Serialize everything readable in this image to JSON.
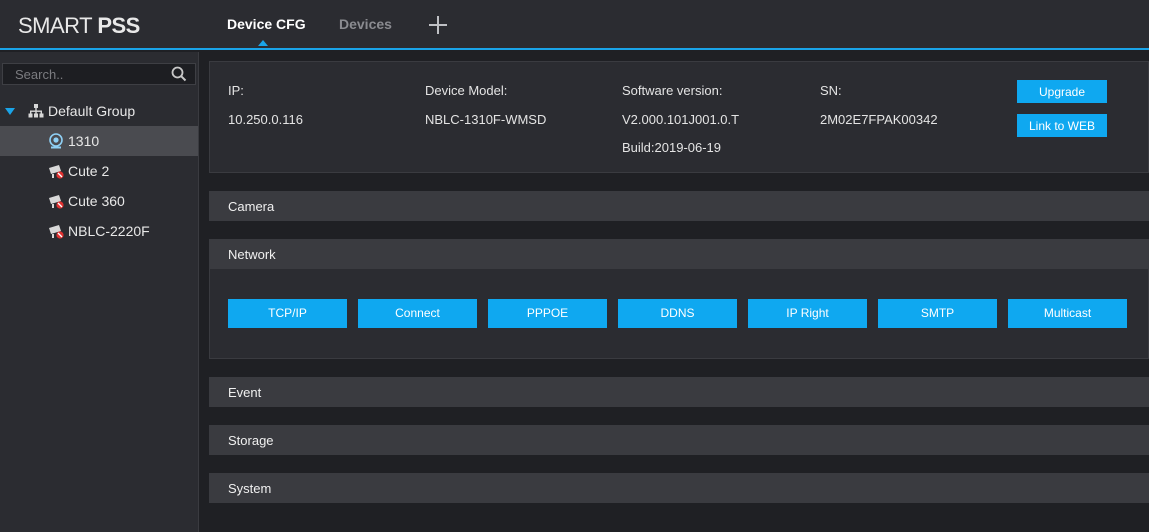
{
  "app": {
    "logo_light": "SMART ",
    "logo_bold": "PSS"
  },
  "tabs": [
    {
      "label": "Device CFG",
      "active": true
    },
    {
      "label": "Devices",
      "active": false
    }
  ],
  "sidebar": {
    "search_placeholder": "Search..",
    "group": {
      "label": "Default Group",
      "expanded": true
    },
    "devices": [
      {
        "label": "1310",
        "online": true,
        "selected": true
      },
      {
        "label": "Cute 2",
        "online": false
      },
      {
        "label": "Cute 360",
        "online": false
      },
      {
        "label": "NBLC-2220F",
        "online": false
      }
    ]
  },
  "device_info": {
    "ip_label": "IP:",
    "ip_value": "10.250.0.116",
    "model_label": "Device Model:",
    "model_value": "NBLC-1310F-WMSD",
    "sw_label": "Software version:",
    "sw_value": "V2.000.101J001.0.T",
    "build_value": "Build:2019-06-19",
    "sn_label": "SN:",
    "sn_value": "2M02E7FPAK00342",
    "upgrade_label": "Upgrade",
    "link_web_label": "Link to WEB"
  },
  "sections": {
    "camera": "Camera",
    "network": "Network",
    "event": "Event",
    "storage": "Storage",
    "system": "System"
  },
  "network_buttons": [
    "TCP/IP",
    "Connect",
    "PPPOE",
    "DDNS",
    "IP Right",
    "SMTP",
    "Multicast"
  ],
  "colors": {
    "accent": "#1aa4e8",
    "button": "#0fa8f0",
    "offline_badge": "#e03030"
  }
}
